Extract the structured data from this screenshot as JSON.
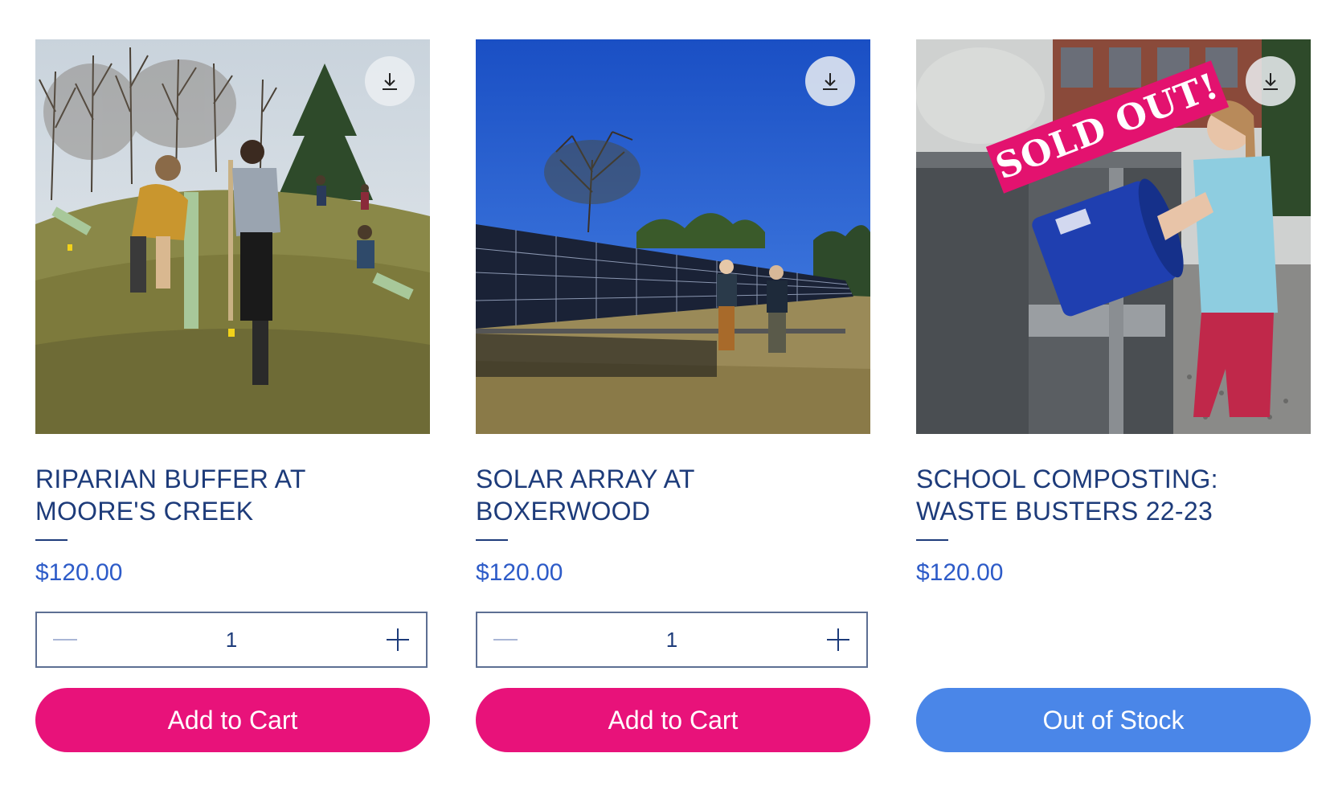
{
  "products": [
    {
      "title": "RIPARIAN BUFFER AT MOORE'S CREEK",
      "price": "$120.00",
      "quantity": "1",
      "button_label": "Add to Cart",
      "download_icon": "download-icon",
      "image": "photo of students planting tree tubes on a grassy hillside"
    },
    {
      "title": "SOLAR ARRAY AT BOXERWOOD",
      "price": "$120.00",
      "quantity": "1",
      "button_label": "Add to Cart",
      "download_icon": "download-icon",
      "image": "photo of two people standing by a solar panel array under blue sky"
    },
    {
      "title": "SCHOOL COMPOSTING: WASTE BUSTERS 22-23",
      "price": "$120.00",
      "ribbon": "SOLD OUT!",
      "button_label": "Out of Stock",
      "download_icon": "download-icon",
      "image": "photo of a girl emptying a blue bucket into a compost bin"
    }
  ],
  "colors": {
    "title": "#1d3b7a",
    "price": "#2d5bc8",
    "add_to_cart": "#e8127a",
    "out_of_stock": "#4a86e8",
    "sold_out_ribbon": "#e3126f"
  }
}
